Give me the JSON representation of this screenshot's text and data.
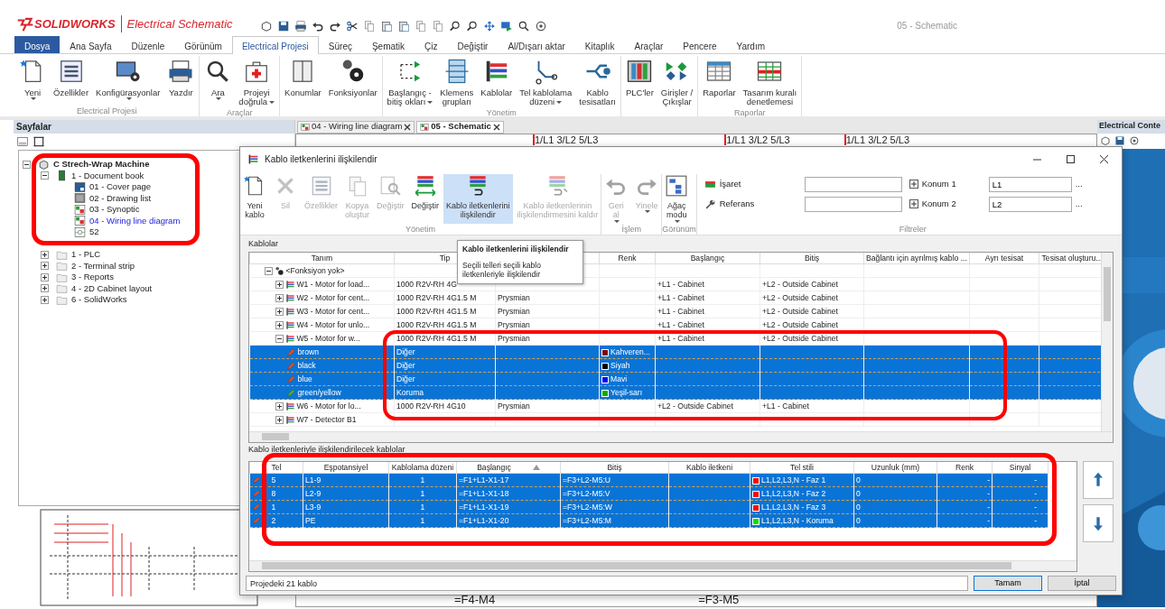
{
  "app": {
    "brand": "SOLIDWORKS",
    "product": "Electrical Schematic",
    "document_title": "05 - Schematic"
  },
  "menu_tabs": [
    {
      "label": "Dosya",
      "kind": "file",
      "selected": false
    },
    {
      "label": "Ana Sayfa",
      "kind": "tab",
      "selected": false
    },
    {
      "label": "Düzenle",
      "kind": "tab",
      "selected": false
    },
    {
      "label": "Görünüm",
      "kind": "tab",
      "selected": false
    },
    {
      "label": "Electrical Projesi",
      "kind": "tab",
      "selected": true
    },
    {
      "label": "Süreç",
      "kind": "tab",
      "selected": false
    },
    {
      "label": "Şematik",
      "kind": "tab",
      "selected": false
    },
    {
      "label": "Çiz",
      "kind": "tab",
      "selected": false
    },
    {
      "label": "Değiştir",
      "kind": "tab",
      "selected": false
    },
    {
      "label": "Al/Dışarı aktar",
      "kind": "tab",
      "selected": false
    },
    {
      "label": "Kitaplık",
      "kind": "tab",
      "selected": false
    },
    {
      "label": "Araçlar",
      "kind": "tab",
      "selected": false
    },
    {
      "label": "Pencere",
      "kind": "tab",
      "selected": false
    },
    {
      "label": "Yardım",
      "kind": "tab",
      "selected": false
    }
  ],
  "ribbon_groups": [
    {
      "label": "Electrical Projesi",
      "buttons": [
        {
          "label": "Yeni",
          "kind": "new",
          "dropdown": true
        },
        {
          "label": "Özellikler",
          "kind": "properties",
          "dropdown": false
        },
        {
          "label": "Konfigürasyonlar",
          "kind": "config",
          "dropdown": true
        },
        {
          "label": "Yazdır",
          "kind": "print",
          "dropdown": false
        }
      ]
    },
    {
      "label": "Araçlar",
      "buttons": [
        {
          "label": "Ara",
          "kind": "search",
          "dropdown": true
        },
        {
          "label": "Projeyi\ndoğrula",
          "kind": "check",
          "dropdown": true
        }
      ]
    },
    {
      "buttons": [
        {
          "label": "Konumlar",
          "kind": "cabinet",
          "dropdown": false
        },
        {
          "label": "Fonksiyonlar",
          "kind": "gears",
          "dropdown": false
        }
      ]
    },
    {
      "label": "Yönetim",
      "buttons": [
        {
          "label": "Başlangıç -\nbitiş okları",
          "kind": "arrows",
          "dropdown": true
        },
        {
          "label": "Klemens\ngrupları",
          "kind": "terminal",
          "dropdown": false
        },
        {
          "label": "Kablolar",
          "kind": "cables",
          "dropdown": false
        },
        {
          "label": "Tel kablolama\ndüzeni",
          "kind": "wiring",
          "dropdown": true
        },
        {
          "label": "Kablo\ntesisatları",
          "kind": "harness",
          "dropdown": false
        }
      ]
    },
    {
      "buttons": [
        {
          "label": "PLC'ler",
          "kind": "plc",
          "dropdown": false
        },
        {
          "label": "Girişler /\nÇıkışlar",
          "kind": "io",
          "dropdown": false
        }
      ]
    },
    {
      "label": "Raporlar",
      "buttons": [
        {
          "label": "Raporlar",
          "kind": "report",
          "dropdown": false
        },
        {
          "label": "Tasarım kuralı\ndenetlemesi",
          "kind": "rules",
          "dropdown": false
        }
      ]
    }
  ],
  "pages_panel": {
    "title": "Sayfalar",
    "tree": [
      {
        "label": "C Strech-Wrap Machine",
        "kind": "project",
        "expanded": true,
        "children": [
          {
            "label": "1 - Document book",
            "kind": "book",
            "expanded": true,
            "children": [
              {
                "label": "01 - Cover page",
                "kind": "cover",
                "active": false
              },
              {
                "label": "02 - Drawing list",
                "kind": "list",
                "active": false
              },
              {
                "label": "03 - Synoptic",
                "kind": "synoptic",
                "active": false
              },
              {
                "label": "04 - Wiring line diagram",
                "kind": "synoptic",
                "active": true
              },
              {
                "label": "52",
                "kind": "schematic",
                "active": false
              }
            ]
          },
          {
            "label": "1 - PLC",
            "kind": "folder",
            "expanded": false
          },
          {
            "label": "2 - Terminal strip",
            "kind": "folder",
            "expanded": false
          },
          {
            "label": "3 - Reports",
            "kind": "folder",
            "expanded": false
          },
          {
            "label": "4 - 2D Cabinet layout",
            "kind": "folder",
            "expanded": false
          },
          {
            "label": "6 - SolidWorks",
            "kind": "folder",
            "expanded": false
          }
        ]
      }
    ]
  },
  "document_tabs": [
    {
      "label": "04 - Wiring line diagram",
      "selected": false
    },
    {
      "label": "05 - Schematic",
      "selected": true
    }
  ],
  "canvas": {
    "top_labels": [
      "1/L1 3/L2 5/L3",
      "1/L1 3/L2 5/L3",
      "1/L1 3/L2 5/L3"
    ],
    "bottom_labels": [
      "=F4-M4",
      "=F3-M5"
    ]
  },
  "content_panel": {
    "title": "Electrical Conte"
  },
  "dialog": {
    "title": "Kablo iletkenlerini ilişkilendir",
    "toolbar_groups": [
      {
        "label": "Yönetim",
        "buttons": [
          {
            "label": "Yeni\nkablo",
            "kind": "new",
            "disabled": false,
            "selected": false,
            "dropdown": false
          },
          {
            "label": "Sil",
            "kind": "delete",
            "disabled": true,
            "selected": false,
            "dropdown": false
          },
          {
            "label": "Özellikler",
            "kind": "properties",
            "disabled": true,
            "selected": false,
            "dropdown": false
          },
          {
            "label": "Kopya\noluştur",
            "kind": "copy",
            "disabled": true,
            "selected": false,
            "dropdown": false
          },
          {
            "label": "Değiştir",
            "kind": "docsearch",
            "disabled": true,
            "selected": false,
            "dropdown": false
          },
          {
            "label": "Değiştir",
            "kind": "replace",
            "disabled": false,
            "selected": false,
            "dropdown": false
          },
          {
            "label": "Kablo iletkenlerini\nilişkilendir",
            "kind": "link",
            "disabled": false,
            "selected": true,
            "dropdown": false
          },
          {
            "label": "Kablo iletkenlerinin\nilişkilendirmesini kaldır",
            "kind": "unlink",
            "disabled": true,
            "selected": false,
            "dropdown": false
          }
        ]
      },
      {
        "label": "İşlem",
        "buttons": [
          {
            "label": "Geri\nal",
            "kind": "undo",
            "disabled": true,
            "selected": false,
            "dropdown": true
          },
          {
            "label": "Yinele",
            "kind": "redo",
            "disabled": true,
            "selected": false,
            "dropdown": true
          }
        ]
      },
      {
        "label": "Görünüm",
        "buttons": [
          {
            "label": "Ağaç\nmodu",
            "kind": "tree",
            "disabled": false,
            "selected": false,
            "dropdown": true
          }
        ]
      }
    ],
    "filters": {
      "label": "Filtreler",
      "rows": [
        {
          "label": "İşaret",
          "kind": "mark",
          "location_label": "Konum 1",
          "location_value": "L1",
          "more": "..."
        },
        {
          "label": "Referans",
          "kind": "reference",
          "location_label": "Konum 2",
          "location_value": "L2",
          "more": "..."
        }
      ]
    },
    "tooltip": {
      "title": "Kablo iletkenlerini ilişkilendir",
      "text": "Seçili telleri seçili kablo iletkenleriyle ilişkilendir"
    },
    "cables_section": {
      "label": "Kablolar",
      "columns": [
        {
          "label": "Tanım"
        },
        {
          "label": "Tip"
        },
        {},
        {
          "label": "Renk"
        },
        {
          "label": "Başlangıç"
        },
        {
          "label": "Bitiş"
        },
        {
          "label": "Bağlantı için ayrılmış kablo ..."
        },
        {
          "label": "Ayrı tesisat"
        },
        {
          "label": "Tesisat oluşturu..."
        }
      ],
      "rows": [
        {
          "kind": "function",
          "description": "<Fonksiyon yok>",
          "expanded": true,
          "children": [
            {
              "kind": "cable",
              "description": "W1 - Motor for load...",
              "type": "1000 R2V-RH 4G",
              "start": "+L1 - Cabinet",
              "end": "+L2 - Outside Cabinet",
              "expanded": false
            },
            {
              "kind": "cable",
              "description": "W2 - Motor for cent...",
              "type": "1000 R2V-RH 4G1.5 M",
              "manufacturer": "Prysmian",
              "start": "+L1 - Cabinet",
              "end": "+L2 - Outside Cabinet",
              "expanded": false
            },
            {
              "kind": "cable",
              "description": "W3 - Motor for cent...",
              "type": "1000 R2V-RH 4G1.5 M",
              "manufacturer": "Prysmian",
              "start": "+L1 - Cabinet",
              "end": "+L2 - Outside Cabinet",
              "expanded": false
            },
            {
              "kind": "cable",
              "description": "W4 - Motor for unlo...",
              "type": "1000 R2V-RH 4G1.5 M",
              "manufacturer": "Prysmian",
              "start": "+L1 - Cabinet",
              "end": "+L2 - Outside Cabinet",
              "expanded": false
            },
            {
              "kind": "cable",
              "description": "W5 - Motor for w...",
              "type": "1000 R2V-RH 4G1.5 M",
              "manufacturer": "Prysmian",
              "start": "+L1 - Cabinet",
              "end": "+L2 - Outside Cabinet",
              "expanded": true,
              "children": [
                {
                  "kind": "conductor",
                  "description": "brown",
                  "type": "Diğer",
                  "color": "#800000",
                  "color_name": "Kahveren...",
                  "selected": true
                },
                {
                  "kind": "conductor",
                  "description": "black",
                  "type": "Diğer",
                  "color": "#000000",
                  "color_name": "Siyah",
                  "selected": true
                },
                {
                  "kind": "conductor",
                  "description": "blue",
                  "type": "Diğer",
                  "color": "#0000ff",
                  "color_name": "Mavi",
                  "selected": true
                },
                {
                  "kind": "earth",
                  "description": "green/yellow",
                  "type": "Koruma",
                  "color": "#00b000",
                  "color_name": "Yeşil-sarı",
                  "selected": true
                }
              ]
            },
            {
              "kind": "cable",
              "description": "W6 - Motor for lo...",
              "type": "1000 R2V-RH 4G10",
              "manufacturer": "Prysmian",
              "start": "+L2 - Outside Cabinet",
              "end": "+L1 - Cabinet",
              "expanded": false
            },
            {
              "kind": "cable",
              "description": "W7 - Detector B1",
              "expanded": false
            }
          ]
        }
      ]
    },
    "wires_section": {
      "label": "Kablo iletkenleriyle ilişkilendirilecek kablolar",
      "columns": [
        {
          "label": "Tel",
          "sorted": false
        },
        {
          "label": "Eşpotansiyel",
          "sorted": false
        },
        {
          "label": "Kablolama düzeni",
          "sorted": false
        },
        {
          "label": "Başlangıç",
          "sorted": true
        },
        {
          "label": "Bitiş",
          "sorted": false
        },
        {
          "label": "Kablo iletkeni",
          "sorted": false
        },
        {
          "label": "Tel stili",
          "sorted": false
        },
        {
          "label": "Uzunluk (mm)",
          "sorted": false
        },
        {
          "label": "Renk",
          "sorted": false
        },
        {
          "label": "Sinyal",
          "sorted": false
        }
      ],
      "rows": [
        {
          "wire": "5",
          "equipotential": "L1-9",
          "order": "1",
          "start": "=F1+L1-X1-17",
          "end": "=F3+L2-M5:U",
          "color": "#ff0000",
          "style": "L1,L2,L3,N - Faz 1",
          "length": "0",
          "color_label": "-",
          "signal": "-",
          "selected": true
        },
        {
          "wire": "8",
          "equipotential": "L2-9",
          "order": "1",
          "start": "=F1+L1-X1-18",
          "end": "=F3+L2-M5:V",
          "color": "#ff0000",
          "style": "L1,L2,L3,N - Faz 2",
          "length": "0",
          "color_label": "-",
          "signal": "-",
          "selected": true
        },
        {
          "wire": "1",
          "equipotential": "L3-9",
          "order": "1",
          "start": "=F1+L1-X1-19",
          "end": "=F3+L2-M5:W",
          "color": "#ff0000",
          "style": "L1,L2,L3,N - Faz 3",
          "length": "0",
          "color_label": "-",
          "signal": "-",
          "selected": true
        },
        {
          "wire": "2",
          "equipotential": "PE",
          "order": "1",
          "start": "=F1+L1-X1-20",
          "end": "=F3+L2-M5:M",
          "color": "#00e000",
          "style": "L1,L2,L3,N - Koruma",
          "length": "0",
          "color_label": "-",
          "signal": "-",
          "selected": true
        }
      ]
    },
    "status": "Projedeki 21 kablo",
    "buttons": [
      {
        "label": "Tamam",
        "default": true
      },
      {
        "label": "İptal",
        "default": false
      }
    ]
  },
  "highlight_frames": [
    {
      "kind": "frame"
    },
    {
      "kind": "frame"
    },
    {
      "kind": "frame"
    }
  ]
}
